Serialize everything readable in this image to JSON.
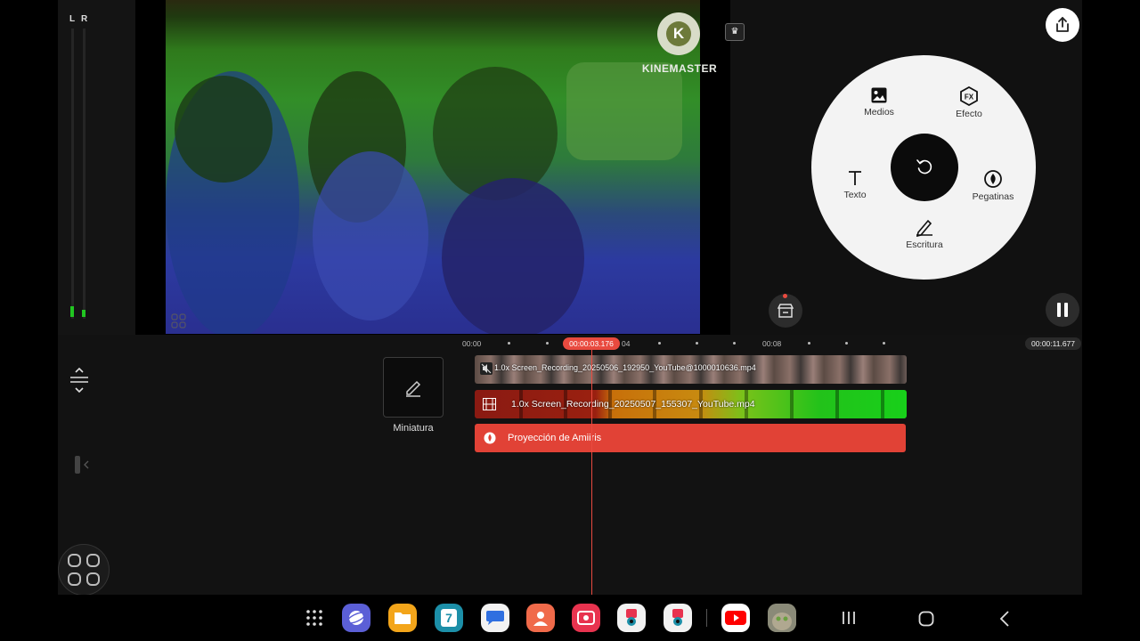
{
  "meter": {
    "left_label": "L",
    "right_label": "R"
  },
  "watermark": {
    "logo_letter": "K",
    "brand": "KINEMASTER"
  },
  "wheel": {
    "items": {
      "media": "Medios",
      "effect": "Efecto",
      "text": "Texto",
      "stickers": "Pegatinas",
      "handwriting": "Escritura"
    }
  },
  "timeline": {
    "ticks": [
      "00:00",
      "04",
      "00:08"
    ],
    "playhead_time": "00:00:03.176",
    "total_time": "00:00:11.677",
    "thumbnail_label": "Miniatura",
    "tracks": [
      {
        "label": "1.0x Screen_Recording_20250506_192950_YouTube@1000010636.mp4"
      },
      {
        "label": "1.0x Screen_Recording_20250507_155307_YouTube.mp4"
      },
      {
        "label": "Proyección de Amiiris"
      }
    ]
  },
  "navbar": {
    "apps": [
      {
        "name": "app-drawer",
        "color": "#000000"
      },
      {
        "name": "samsung-internet",
        "color": "#5b5fd6"
      },
      {
        "name": "my-files",
        "color": "#f3a51a"
      },
      {
        "name": "calendar",
        "color": "#1c8fa8",
        "glyph": "7"
      },
      {
        "name": "messages",
        "color": "#f2f2f2"
      },
      {
        "name": "contacts",
        "color": "#f06a4a"
      },
      {
        "name": "screen-recorder",
        "color": "#e8334f"
      },
      {
        "name": "camera-app-1",
        "color": "#f2f2f2"
      },
      {
        "name": "camera-app-2",
        "color": "#f2f2f2"
      },
      {
        "name": "youtube",
        "color": "#ffffff"
      },
      {
        "name": "talking-tom",
        "color": "#7b7b6a"
      }
    ]
  }
}
